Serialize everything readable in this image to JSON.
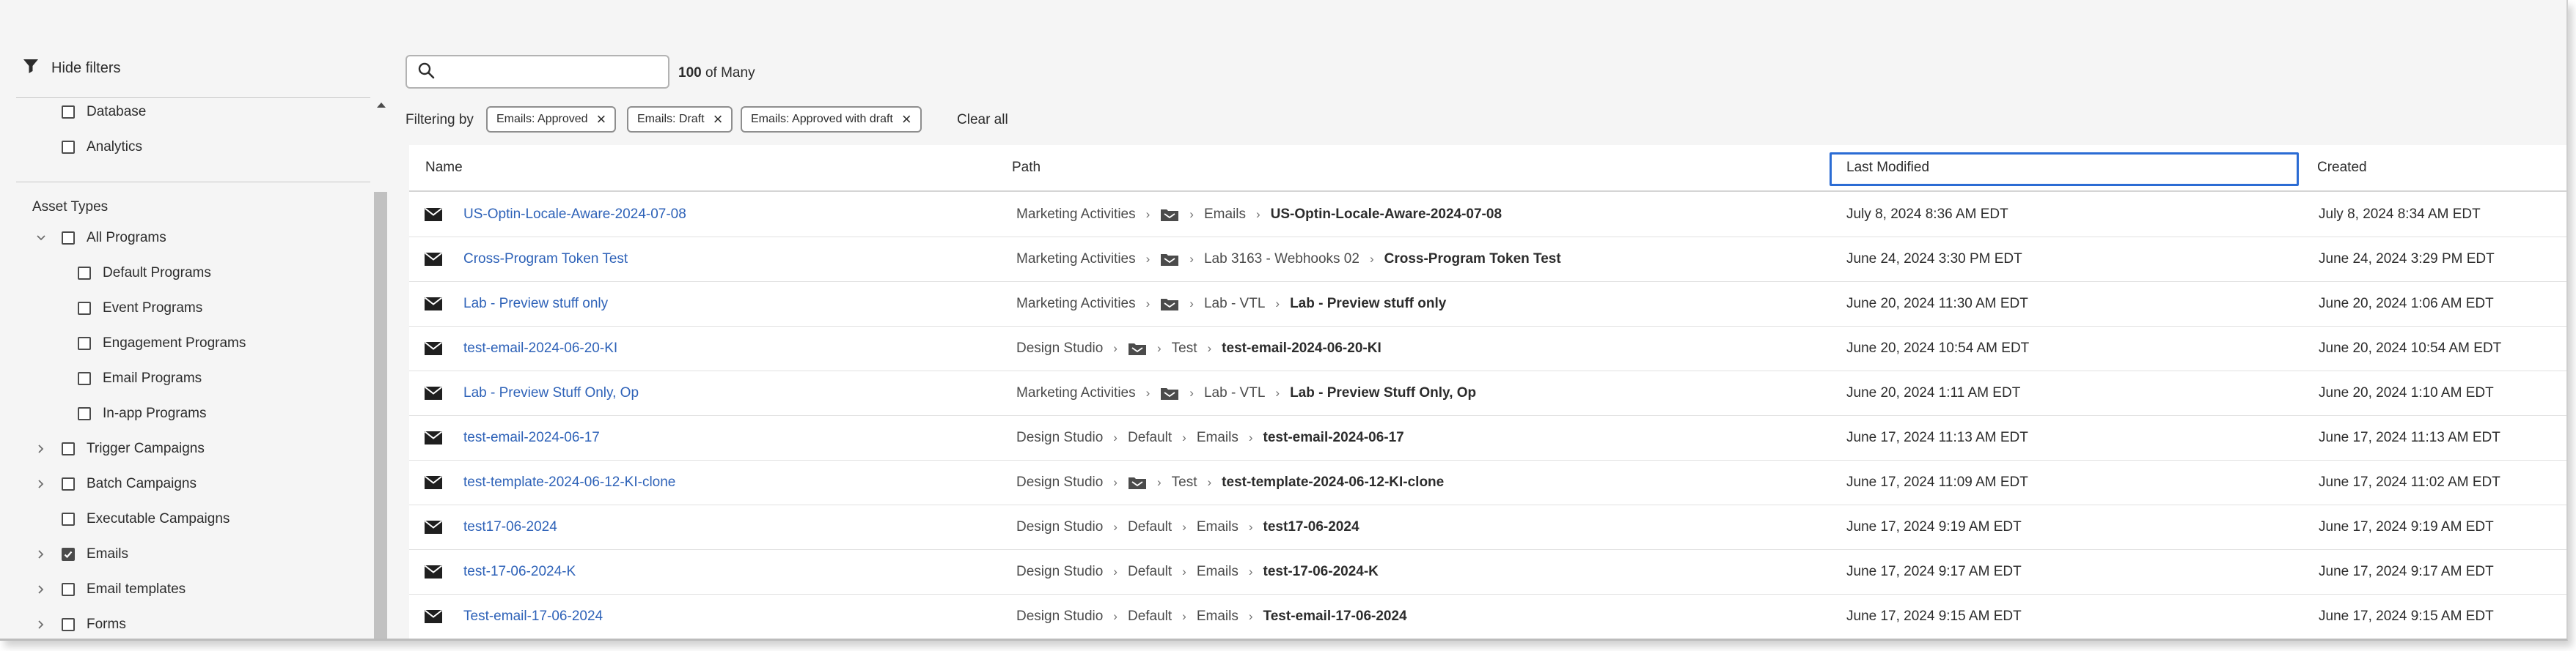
{
  "sidebar": {
    "hide_filters_label": "Hide filters",
    "top_items": [
      {
        "label": "Database",
        "checked": false
      },
      {
        "label": "Analytics",
        "checked": false
      }
    ],
    "asset_types_title": "Asset Types",
    "tree": [
      {
        "label": "All Programs",
        "checked": false,
        "expandable": true,
        "expanded": true,
        "level": 0
      },
      {
        "label": "Default Programs",
        "checked": false,
        "expandable": false,
        "level": 1
      },
      {
        "label": "Event Programs",
        "checked": false,
        "expandable": false,
        "level": 1
      },
      {
        "label": "Engagement Programs",
        "checked": false,
        "expandable": false,
        "level": 1
      },
      {
        "label": "Email Programs",
        "checked": false,
        "expandable": false,
        "level": 1
      },
      {
        "label": "In-app Programs",
        "checked": false,
        "expandable": false,
        "level": 1
      },
      {
        "label": "Trigger Campaigns",
        "checked": false,
        "expandable": true,
        "expanded": false,
        "level": 0
      },
      {
        "label": "Batch Campaigns",
        "checked": false,
        "expandable": true,
        "expanded": false,
        "level": 0
      },
      {
        "label": "Executable Campaigns",
        "checked": false,
        "expandable": false,
        "level": 0
      },
      {
        "label": "Emails",
        "checked": true,
        "expandable": true,
        "expanded": false,
        "level": 0
      },
      {
        "label": "Email templates",
        "checked": false,
        "expandable": true,
        "expanded": false,
        "level": 0
      },
      {
        "label": "Forms",
        "checked": false,
        "expandable": true,
        "expanded": false,
        "level": 0
      }
    ]
  },
  "search": {
    "placeholder": "",
    "value": ""
  },
  "count": {
    "number": "100",
    "suffix": "of Many"
  },
  "filters": {
    "label": "Filtering by",
    "chips": [
      "Emails: Approved",
      "Emails: Draft",
      "Emails: Approved with draft"
    ],
    "clear_all": "Clear all"
  },
  "table": {
    "columns": {
      "name": "Name",
      "path": "Path",
      "last_modified": "Last Modified",
      "created": "Created"
    },
    "rows": [
      {
        "name": "US-Optin-Locale-Aware-2024-07-08",
        "path": [
          "Marketing Activities",
          "@folder",
          "Emails",
          "US-Optin-Locale-Aware-2024-07-08"
        ],
        "last_modified": "July 8, 2024 8:36 AM EDT",
        "created": "July 8, 2024 8:34 AM EDT"
      },
      {
        "name": "Cross-Program Token Test",
        "path": [
          "Marketing Activities",
          "@folder",
          "Lab 3163 - Webhooks 02",
          "Cross-Program Token Test"
        ],
        "last_modified": "June 24, 2024 3:30 PM EDT",
        "created": "June 24, 2024 3:29 PM EDT"
      },
      {
        "name": "Lab - Preview stuff only",
        "path": [
          "Marketing Activities",
          "@folder",
          "Lab - VTL",
          "Lab - Preview stuff only"
        ],
        "last_modified": "June 20, 2024 11:30 AM EDT",
        "created": "June 20, 2024 1:06 AM EDT"
      },
      {
        "name": "test-email-2024-06-20-KI",
        "path": [
          "Design Studio",
          "@folder",
          "Test",
          "test-email-2024-06-20-KI"
        ],
        "last_modified": "June 20, 2024 10:54 AM EDT",
        "created": "June 20, 2024 10:54 AM EDT"
      },
      {
        "name": "Lab - Preview Stuff Only, Op",
        "path": [
          "Marketing Activities",
          "@folder",
          "Lab - VTL",
          "Lab - Preview Stuff Only, Op"
        ],
        "last_modified": "June 20, 2024 1:11 AM EDT",
        "created": "June 20, 2024 1:10 AM EDT"
      },
      {
        "name": "test-email-2024-06-17",
        "path": [
          "Design Studio",
          "Default",
          "Emails",
          "test-email-2024-06-17"
        ],
        "last_modified": "June 17, 2024 11:13 AM EDT",
        "created": "June 17, 2024 11:13 AM EDT"
      },
      {
        "name": "test-template-2024-06-12-KI-clone",
        "path": [
          "Design Studio",
          "@folder",
          "Test",
          "test-template-2024-06-12-KI-clone"
        ],
        "last_modified": "June 17, 2024 11:09 AM EDT",
        "created": "June 17, 2024 11:02 AM EDT"
      },
      {
        "name": "test17-06-2024",
        "path": [
          "Design Studio",
          "Default",
          "Emails",
          "test17-06-2024"
        ],
        "last_modified": "June 17, 2024 9:19 AM EDT",
        "created": "June 17, 2024 9:19 AM EDT"
      },
      {
        "name": "test-17-06-2024-K",
        "path": [
          "Design Studio",
          "Default",
          "Emails",
          "test-17-06-2024-K"
        ],
        "last_modified": "June 17, 2024 9:17 AM EDT",
        "created": "June 17, 2024 9:17 AM EDT"
      },
      {
        "name": "Test-email-17-06-2024",
        "path": [
          "Design Studio",
          "Default",
          "Emails",
          "Test-email-17-06-2024"
        ],
        "last_modified": "June 17, 2024 9:15 AM EDT",
        "created": "June 17, 2024 9:15 AM EDT"
      }
    ]
  },
  "colors": {
    "link": "#2e62b8",
    "focus_outline": "#2b6cd4",
    "background": "#f5f5f5"
  }
}
